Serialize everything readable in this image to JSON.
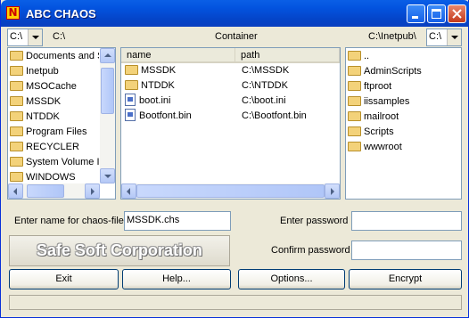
{
  "window": {
    "title": "ABC CHAOS",
    "app_icon": "chaos-app-icon"
  },
  "title_buttons": [
    "minimize-icon",
    "maximize-icon",
    "close-icon"
  ],
  "left_drive": {
    "value": "C:\\",
    "path": "C:\\"
  },
  "center_header": "Container",
  "right_drive": {
    "path": "C:\\Inetpub\\",
    "value": "C:\\"
  },
  "left_tree": [
    "Documents and S",
    "Inetpub",
    "MSOCache",
    "MSSDK",
    "NTDDK",
    "Program Files",
    "RECYCLER",
    "System Volume In",
    "WINDOWS"
  ],
  "file_list": {
    "columns": [
      "name",
      "path"
    ],
    "rows": [
      {
        "name": "MSSDK",
        "path": "C:\\MSSDK",
        "icon": "folder-icon"
      },
      {
        "name": "NTDDK",
        "path": "C:\\NTDDK",
        "icon": "folder-icon"
      },
      {
        "name": "boot.ini",
        "path": "C:\\boot.ini",
        "icon": "file-icon"
      },
      {
        "name": "Bootfont.bin",
        "path": "C:\\Bootfont.bin",
        "icon": "file-icon"
      }
    ]
  },
  "right_tree": [
    "..",
    "AdminScripts",
    "ftproot",
    "iissamples",
    "mailroot",
    "Scripts",
    "wwwroot"
  ],
  "form": {
    "chaos_file_label": "Enter name for chaos-file",
    "chaos_file_value": "MSSDK.chs",
    "enter_password_label": "Enter password",
    "enter_password_value": "",
    "confirm_password_label": "Confirm password",
    "confirm_password_value": ""
  },
  "brand": "Safe Soft Corporation",
  "buttons": {
    "exit": "Exit",
    "help": "Help...",
    "options": "Options...",
    "encrypt": "Encrypt"
  },
  "colors": {
    "title_bar": "#0353df",
    "face": "#ece9d8",
    "border": "#7f9db9"
  }
}
